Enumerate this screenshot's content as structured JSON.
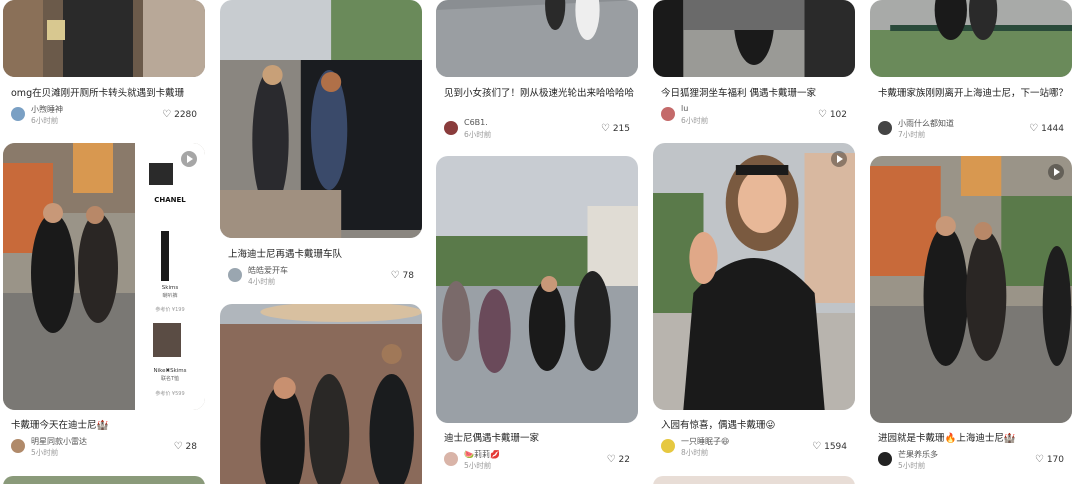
{
  "feed": {
    "columns": [
      {
        "cards": [
          {
            "title": "omg在贝滩刚开厕所卡转头就遇到卡戴珊",
            "author": "小煦睡神",
            "time": "6小时前",
            "likes": "2280",
            "avatar_color": "#7aa0c4"
          },
          {
            "title": "卡戴珊今天在迪士尼🏰",
            "author": "明星同款小雷达",
            "time": "5小时前",
            "likes": "28",
            "avatar_color": "#b08a6a",
            "product_panel": {
              "brand": "CHANEL",
              "item1_caption": "经典款式\n参考价 ¥999",
              "item2_name": "Skims",
              "item2_caption": "喇叭裤",
              "item2_price": "参考价 ¥199",
              "item3_name": "Nike✖Skims",
              "item3_caption": "联名T恤",
              "item3_price": "参考价 ¥599"
            }
          }
        ]
      },
      {
        "cards": [
          {
            "title": "上海迪士尼再遇卡戴珊车队",
            "author": "皓皓爱开车",
            "time": "4小时前",
            "likes": "78",
            "avatar_color": "#9aa6b0"
          }
        ]
      },
      {
        "cards": [
          {
            "title": "见到小女孩们了！刚从极速光轮出来哈哈哈哈",
            "author": "C6B1.",
            "time": "6小时前",
            "likes": "215",
            "avatar_color": "#8a3c3c"
          },
          {
            "title": "迪士尼偶遇卡戴珊一家",
            "author": "🍉莉莉💋",
            "time": "5小时前",
            "likes": "22",
            "avatar_color": "#d9b4a8"
          }
        ]
      },
      {
        "cards": [
          {
            "title": "今日狐狸洞坐车福利 偶遇卡戴珊一家",
            "author": "lu",
            "time": "6小时前",
            "likes": "102",
            "avatar_color": "#c46a6a"
          },
          {
            "title": "入园有惊喜，偶遇卡戴珊😜",
            "author": "一只睡眠子😆",
            "time": "8小时前",
            "likes": "1594",
            "avatar_color": "#e6c840"
          }
        ]
      },
      {
        "cards": [
          {
            "title": "卡戴珊家族刚刚离开上海迪士尼，下一站哪？",
            "author": "小雨什么都知道",
            "time": "7小时前",
            "likes": "1444",
            "avatar_color": "#444444"
          },
          {
            "title": "进园就是卡戴珊🔥上海迪士尼🏰",
            "author": "芒果养乐多",
            "time": "5小时前",
            "likes": "170",
            "avatar_color": "#222222"
          }
        ]
      }
    ]
  },
  "colors": {
    "accent": "#ff2442",
    "text": "#222222",
    "muted": "#999999"
  },
  "icons": {
    "like": "heart-icon",
    "video": "play-icon"
  }
}
